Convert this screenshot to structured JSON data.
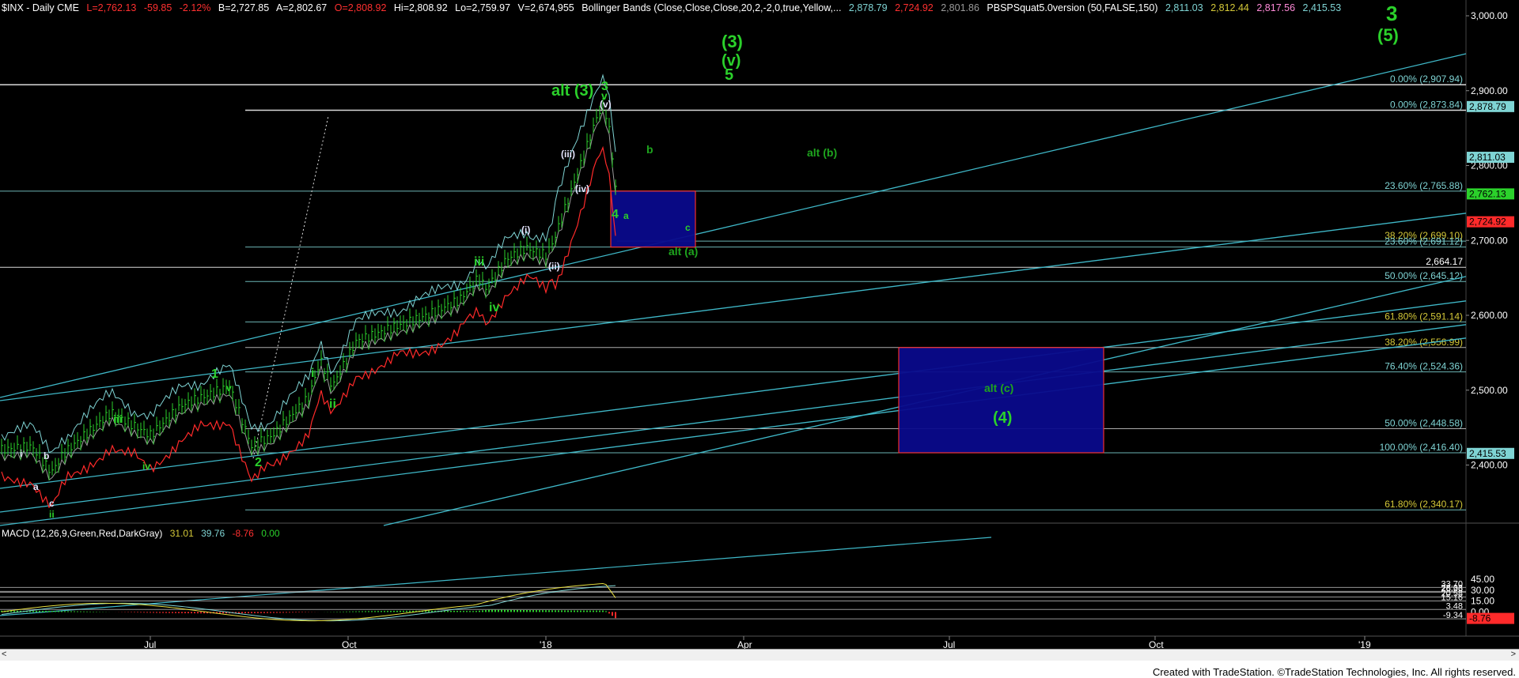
{
  "header": {
    "symbol": "$INX - Daily  CME",
    "last": "L=2,762.13",
    "change": "-59.85",
    "pct": "-2.12%",
    "bid": "B=2,727.85",
    "ask": "A=2,802.67",
    "open": "O=2,808.92",
    "high": "Hi=2,808.92",
    "low": "Lo=2,759.97",
    "vol": "V=2,674,955",
    "bb_label": "Bollinger Bands (Close,Close,Close,20,2,-2,0,true,Yellow,...",
    "bb_upper": "2,878.79",
    "bb_lower": "2,724.92",
    "bb_mid": "2,801.86",
    "pbs_label": "PBSPSquat5.0version (50,FALSE,150)",
    "pbs_v1": "2,811.03",
    "pbs_v2": "2,812.44",
    "pbs_v3": "2,817.56",
    "pbs_v4": "2,415.53"
  },
  "macd_header": {
    "label": "MACD (12,26,9,Green,Red,DarkGray)",
    "macd": "31.01",
    "signal": "39.76",
    "hist": "-8.76",
    "zero": "0.00"
  },
  "colors": {
    "background": "#000000",
    "price_bars": "#2bd12b",
    "bb_upper": "#7fd4d4",
    "bb_lower": "#ff2a2a",
    "bb_mid": "#9a9a9a",
    "channels": "#3fb8c8",
    "fib_lines": "#7fd4d4",
    "box_fill": "#0a0a8c",
    "box_border": "#ff3030",
    "wave_labels": "#2bd12b",
    "macd": "#e8e040",
    "signal": "#7fd4d4",
    "hist_pos": "#2bd12b",
    "hist_neg": "#ff2a2a",
    "header_gold": "#d4c838"
  },
  "footer": {
    "credit": "Created with TradeStation. ©TradeStation Technologies, Inc. All rights reserved."
  },
  "scroll": {
    "left": "<",
    "right": ">"
  },
  "chart_data": [
    {
      "type": "line",
      "name": "price",
      "x_ticks": [
        "Jul",
        "Oct",
        "'18",
        "Apr",
        "Jul",
        "Oct",
        "'19"
      ],
      "y_ticks": [
        "3,000.00",
        "2,900.00",
        "2,800.00",
        "2,700.00",
        "2,600.00",
        "2,500.00",
        "2,400.00"
      ],
      "ylim": [
        2320,
        3020
      ],
      "fib_levels": [
        {
          "label": "0.00% (2,907.94)",
          "value": 2907.94
        },
        {
          "label": "0.00% (2,873.84)",
          "value": 2873.84
        },
        {
          "label": "23.60% (2,765.88)",
          "value": 2765.88
        },
        {
          "label": "38.20% (2,699.10)",
          "value": 2699.1
        },
        {
          "label": "23.60% (2,691.12)",
          "value": 2691.12
        },
        {
          "label": "2,664.17",
          "value": 2664.17
        },
        {
          "label": "50.00% (2,645.12)",
          "value": 2645.12
        },
        {
          "label": "61.80% (2,591.14)",
          "value": 2591.14
        },
        {
          "label": "38.20% (2,556.99)",
          "value": 2556.99
        },
        {
          "label": "76.40% (2,524.36)",
          "value": 2524.36
        },
        {
          "label": "50.00% (2,448.58)",
          "value": 2448.58
        },
        {
          "label": "100.00% (2,416.40)",
          "value": 2416.4
        },
        {
          "label": "61.80% (2,340.17)",
          "value": 2340.17
        }
      ],
      "right_tags": [
        {
          "text": "2,878.79",
          "value": 2878.79,
          "color": "#7fd4d4"
        },
        {
          "text": "2,811.03",
          "value": 2811.03,
          "color": "#7fd4d4"
        },
        {
          "text": "2,762.13",
          "value": 2762.13,
          "color": "#2bd12b"
        },
        {
          "text": "2,724.92",
          "value": 2724.92,
          "color": "#ff2a2a"
        },
        {
          "text": "2,415.53",
          "value": 2415.53,
          "color": "#7fd4d4"
        }
      ],
      "wave_labels": [
        {
          "text": "(3)",
          "big": true
        },
        {
          "text": "(v)",
          "big": true
        },
        {
          "text": "5",
          "big": true
        },
        {
          "text": "3",
          "big": true
        },
        {
          "text": "(5)",
          "big": true
        },
        {
          "text": "alt (3)",
          "big": true
        },
        {
          "text": "3",
          "big": false
        },
        {
          "text": "v",
          "big": false
        },
        {
          "text": "(v)",
          "big": false
        },
        {
          "text": "b",
          "big": false
        },
        {
          "text": "alt (b)",
          "big": false
        },
        {
          "text": "(iii)",
          "big": false
        },
        {
          "text": "(iv)",
          "big": false
        },
        {
          "text": "4",
          "big": false
        },
        {
          "text": "a",
          "big": false
        },
        {
          "text": "c",
          "big": false
        },
        {
          "text": "(i)",
          "big": false
        },
        {
          "text": "alt (a)",
          "big": false
        },
        {
          "text": "(ii)",
          "big": false
        },
        {
          "text": "iii",
          "big": false
        },
        {
          "text": "iv",
          "big": false
        },
        {
          "text": "1",
          "big": false
        },
        {
          "text": "v",
          "big": false
        },
        {
          "text": "i",
          "big": false
        },
        {
          "text": "ii",
          "big": false
        },
        {
          "text": "iii",
          "big": false
        },
        {
          "text": "iv",
          "big": false
        },
        {
          "text": "2",
          "big": false
        },
        {
          "text": "i",
          "big": false
        },
        {
          "text": "b",
          "big": false
        },
        {
          "text": "a",
          "big": false
        },
        {
          "text": "c",
          "big": false
        },
        {
          "text": "ii",
          "big": false
        },
        {
          "text": "alt (c)",
          "big": false
        },
        {
          "text": "(4)",
          "big": true
        }
      ]
    },
    {
      "type": "line",
      "name": "macd",
      "y_ticks": [
        "45.00",
        "30.00",
        "15.00",
        "0.00"
      ],
      "ylim": [
        -12,
        55
      ],
      "levels": [
        {
          "label": "33.70",
          "value": 33.7
        },
        {
          "label": "28.33",
          "value": 28.33
        },
        {
          "label": "26.96",
          "value": 26.96
        },
        {
          "label": "20.58",
          "value": 20.58
        },
        {
          "label": "15.16",
          "value": 15.16
        },
        {
          "label": "3.48",
          "value": 3.48
        },
        {
          "label": "-9.34",
          "value": -9.34
        }
      ],
      "current_tag": {
        "text": "-8.76",
        "value": -8.76
      }
    }
  ]
}
